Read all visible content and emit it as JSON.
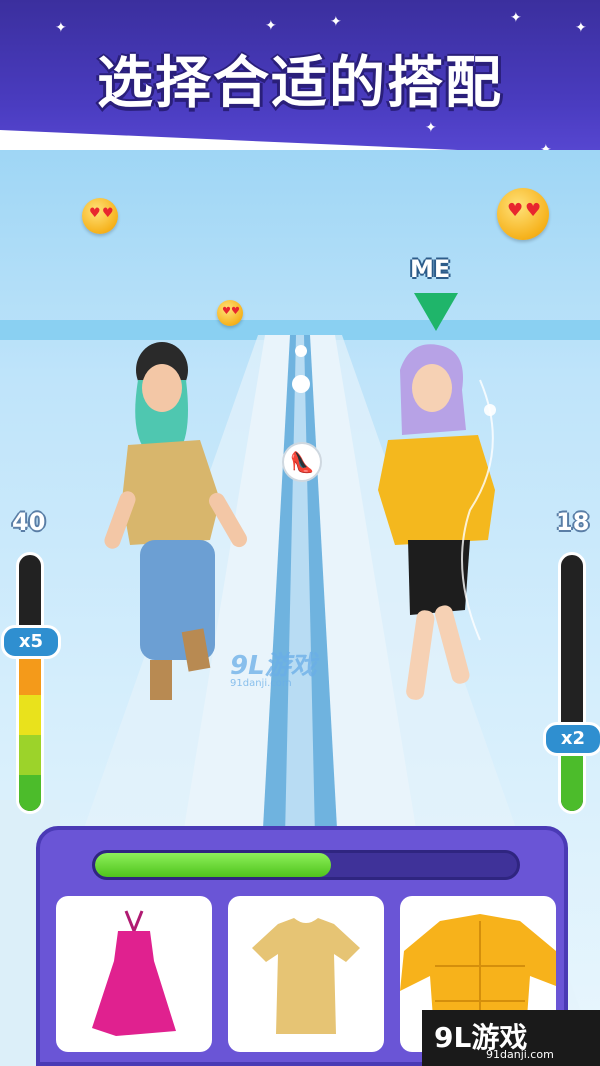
{
  "banner": {
    "title": "选择合适的搭配"
  },
  "hud": {
    "player_marker": "ME",
    "left_meter": {
      "score": "40",
      "multiplier": "x5"
    },
    "right_meter": {
      "score": "18",
      "multiplier": "x2"
    }
  },
  "outfit_panel": {
    "progress": 0.56,
    "options": [
      {
        "item": "pink-halter-dress",
        "color": "#e0218f"
      },
      {
        "item": "beige-tshirt",
        "color": "#e6c474"
      },
      {
        "item": "yellow-puffer-jacket",
        "color": "#f7b21b"
      }
    ]
  },
  "watermark": {
    "logo": "9L游戏",
    "url": "91danji.com"
  },
  "corner_watermark": {
    "logo": "9L游戏",
    "url": "91danji.com"
  },
  "colors": {
    "banner": "#4a3cc0",
    "panel": "#6a55d6",
    "progress_fill": "#4fc31c",
    "me_arrow": "#1fb56a"
  }
}
